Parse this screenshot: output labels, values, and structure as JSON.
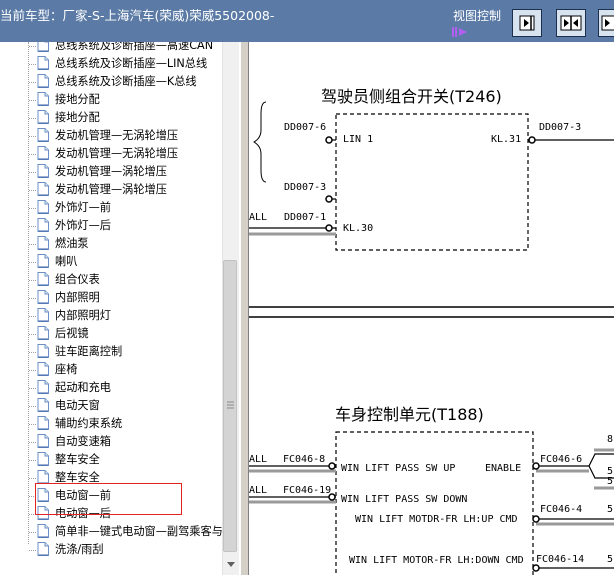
{
  "window": {
    "title": "当前车型：厂家-S-上海汽车(荣威)荣威5502008-",
    "view_control_label": "视图控制"
  },
  "tree": {
    "items": [
      {
        "label": "总线系统及诊断插座—高速CAN"
      },
      {
        "label": "总线系统及诊断插座—LIN总线"
      },
      {
        "label": "总线系统及诊断插座—K总线"
      },
      {
        "label": "接地分配"
      },
      {
        "label": "接地分配"
      },
      {
        "label": "发动机管理—无涡轮增压"
      },
      {
        "label": "发动机管理—无涡轮增压"
      },
      {
        "label": "发动机管理—涡轮增压"
      },
      {
        "label": "发动机管理—涡轮增压"
      },
      {
        "label": "外饰灯—前"
      },
      {
        "label": "外饰灯—后"
      },
      {
        "label": "燃油泵"
      },
      {
        "label": "喇叭"
      },
      {
        "label": "组合仪表"
      },
      {
        "label": "内部照明"
      },
      {
        "label": "内部照明灯"
      },
      {
        "label": "后视镜"
      },
      {
        "label": "驻车距离控制"
      },
      {
        "label": "座椅"
      },
      {
        "label": "起动和充电"
      },
      {
        "label": "电动天窗"
      },
      {
        "label": "辅助约束系统"
      },
      {
        "label": "自动变速箱"
      },
      {
        "label": "整车安全"
      },
      {
        "label": "整车安全"
      },
      {
        "label": "电动窗—前"
      },
      {
        "label": "电动窗—后"
      },
      {
        "label": "简单非—键式电动窗—副驾乘客与"
      },
      {
        "label": "洗涤/雨刮"
      }
    ],
    "highlighted": [
      "电动窗—前",
      "电动窗—后"
    ]
  },
  "diagram": {
    "top": {
      "title": "驾驶员侧组合开关(T246)",
      "wire_dd007_6": "DD007-6",
      "wire_dd007_3_left": "DD007-3",
      "wire_dd007_1": "DD007-1",
      "wire_dd007_3_right": "DD007-3",
      "pin_lin1": "LIN 1",
      "pin_kl31": "KL.31",
      "pin_kl30": "KL.30",
      "all_label": "ALL"
    },
    "bottom": {
      "title": "车身控制单元(T188)",
      "all1": "ALL",
      "all2": "ALL",
      "wire_fc046_8": "FC046-8",
      "wire_fc046_19": "FC046-19",
      "wire_fc046_6": "FC046-6",
      "wire_fc046_4": "FC046-4",
      "wire_fc046_14": "FC046-14",
      "sig1": "WIN LIFT PASS SW UP",
      "sig2": "WIN LIFT PASS SW DOWN",
      "sig3": "WIN LIFT MOTDR-FR LH:UP CMD",
      "sig4": "WIN LIFT MOTOR-FR LH:DOWN CMD",
      "enable": "ENABLE",
      "edge_8": "8",
      "edge_5a": "5",
      "edge_5b": "5",
      "edge_5c": "5",
      "edge_5d": "5"
    }
  },
  "colors": {
    "titlebar": "#5b7ba6",
    "highlight_border": "#e32222",
    "toolbar_button": "#d7e3ef"
  }
}
